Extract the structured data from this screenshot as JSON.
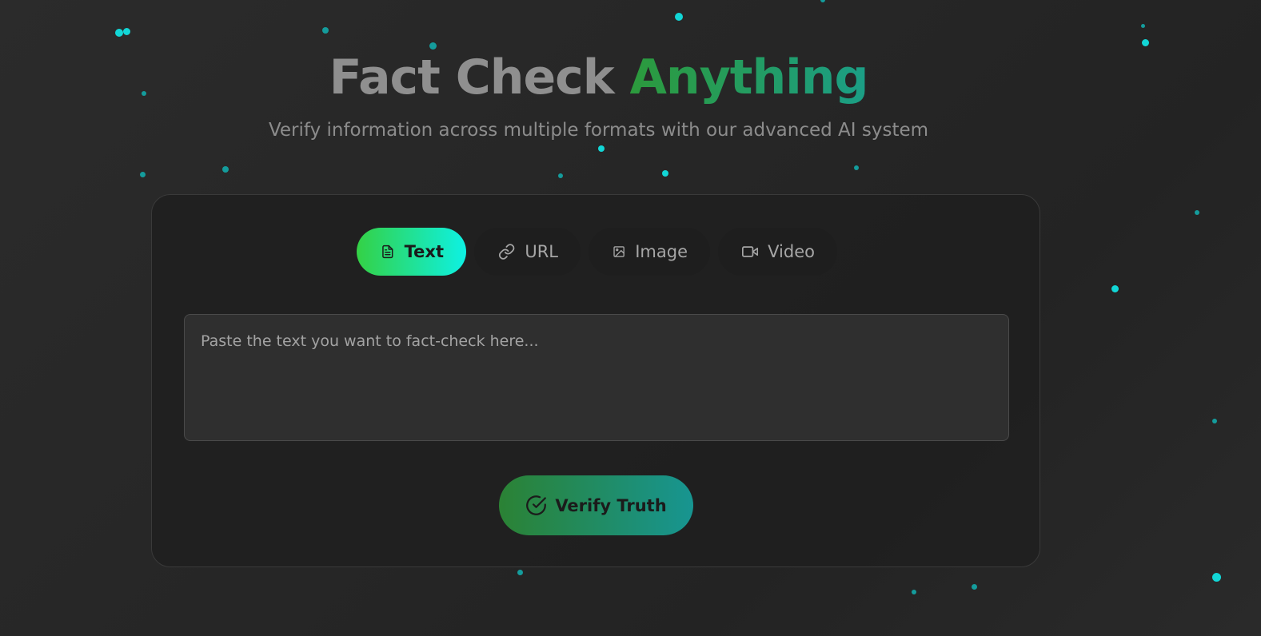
{
  "header": {
    "title_plain": "Fact Check",
    "title_accent": "Anything",
    "subtitle": "Verify information across multiple formats with our advanced AI system"
  },
  "tabs": [
    {
      "label": "Text",
      "icon": "document-icon",
      "active": true
    },
    {
      "label": "URL",
      "icon": "link-icon",
      "active": false
    },
    {
      "label": "Image",
      "icon": "image-icon",
      "active": false
    },
    {
      "label": "Video",
      "icon": "video-icon",
      "active": false
    }
  ],
  "input": {
    "value": "",
    "placeholder": "Paste the text you want to fact-check here..."
  },
  "verify_button": {
    "label": "Verify Truth",
    "icon": "check-circle-icon"
  },
  "colors": {
    "accent_green": "#34d145",
    "accent_cyan": "#0ef1e3",
    "particle": "#12d6d6",
    "background": "#262626"
  }
}
